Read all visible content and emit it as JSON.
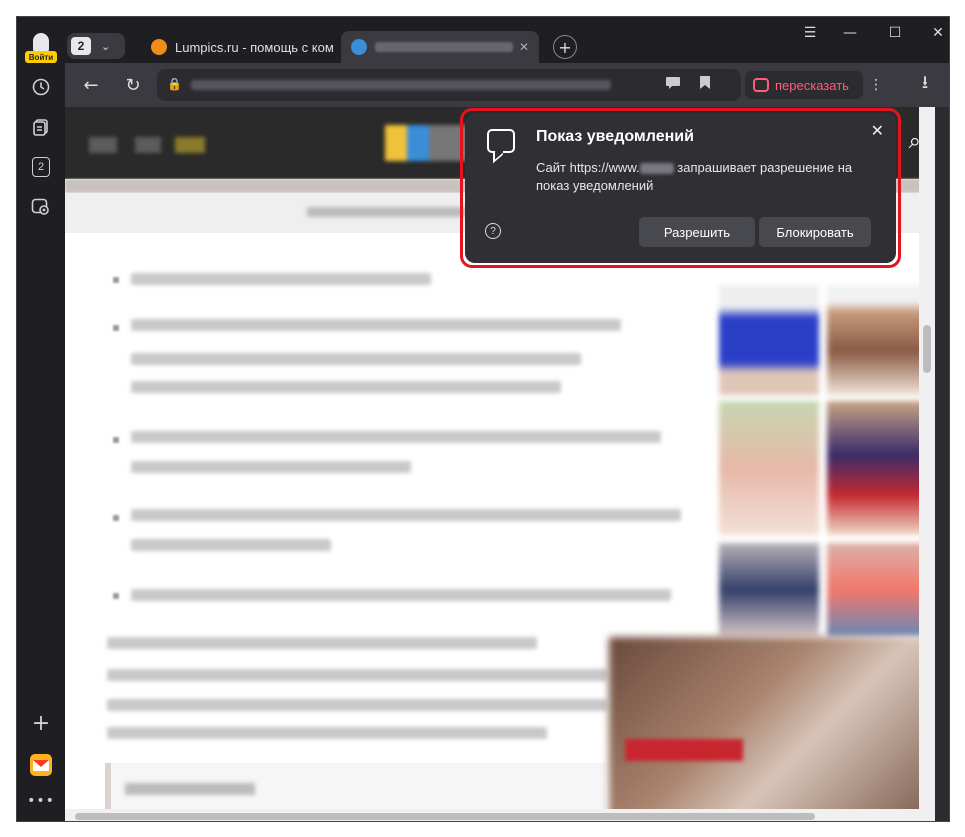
{
  "sidebar": {
    "login_label": "Войти",
    "tab_count": "2",
    "icons": [
      "history-icon",
      "collections-icon",
      "tabs-counter-icon",
      "screenshot-icon",
      "add-icon",
      "mail-icon",
      "more-icon"
    ]
  },
  "tabs": {
    "count": "2",
    "items": [
      {
        "title": "Lumpics.ru - помощь с ком",
        "active": false
      },
      {
        "title": "",
        "active": true
      }
    ],
    "new_tab": "+"
  },
  "window_controls": {
    "menu": "☰",
    "minimize": "—",
    "maximize": "☐",
    "close": "✕"
  },
  "toolbar": {
    "back": "←",
    "reload": "↻",
    "retell_label": "пересказать",
    "more": "⋮",
    "download": "⭳"
  },
  "popup": {
    "title": "Показ уведомлений",
    "message_prefix": "Сайт https://www.",
    "message_suffix": "запрашивает разрешение на показ уведомлений",
    "allow_label": "Разрешить",
    "block_label": "Блокировать",
    "help": "?",
    "close": "✕"
  },
  "colors": {
    "accent_red": "#e3141f",
    "retell_pink": "#ff5d7a",
    "popup_bg": "#2f2f34",
    "sidebar_bg": "#1f1f23"
  }
}
